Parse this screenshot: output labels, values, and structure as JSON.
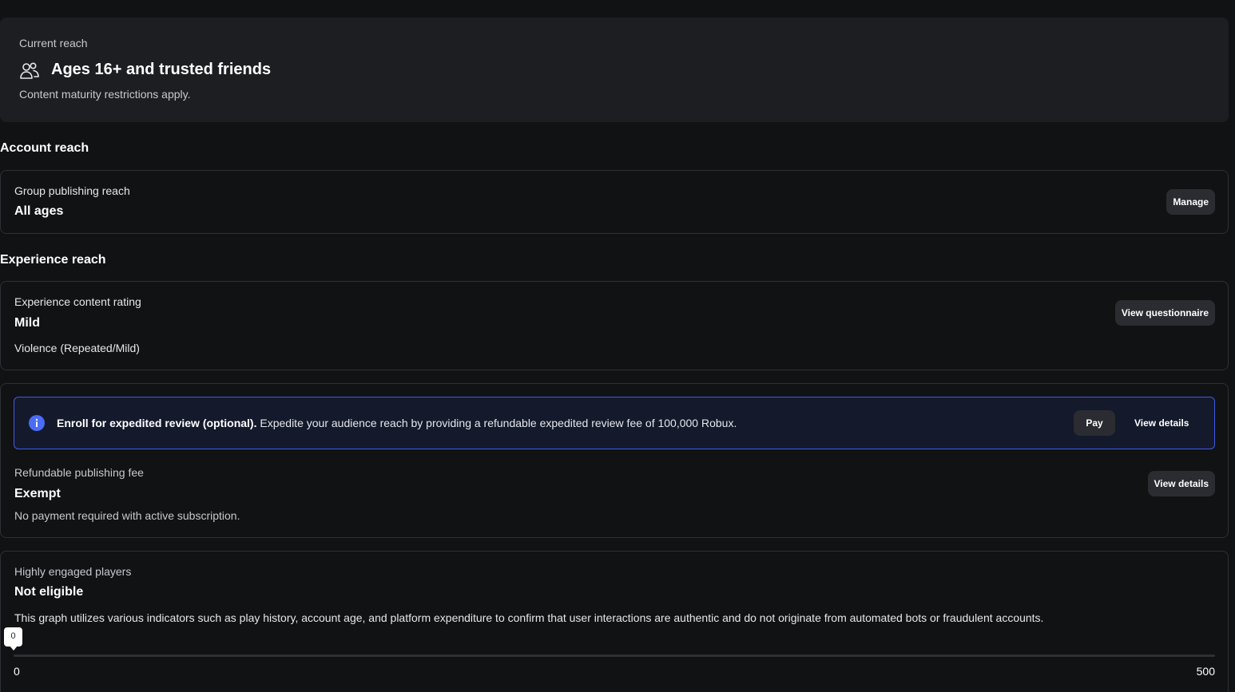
{
  "current_reach": {
    "label": "Current reach",
    "icon": "users-icon",
    "title": "Ages 16+ and trusted friends",
    "subtitle": "Content maturity restrictions apply."
  },
  "account_reach": {
    "heading": "Account reach",
    "group_publishing": {
      "label": "Group publishing reach",
      "value": "All ages",
      "button": "Manage"
    }
  },
  "experience_reach": {
    "heading": "Experience reach",
    "content_rating": {
      "label": "Experience content rating",
      "value": "Mild",
      "descriptor": "Violence (Repeated/Mild)",
      "button": "View questionnaire"
    },
    "expedited_banner": {
      "icon": "info-icon",
      "title": "Enroll for expedited review (optional).",
      "text": "Expedite your audience reach by providing a refundable expedited review fee of 100,000 Robux.",
      "pay_button": "Pay",
      "details_button": "View details",
      "accent": "#3f5ae8"
    },
    "publishing_fee": {
      "label": "Refundable publishing fee",
      "value": "Exempt",
      "description": "No payment required with active subscription.",
      "button": "View details"
    },
    "engaged_players": {
      "label": "Highly engaged players",
      "value": "Not eligible",
      "description": "This graph utilizes various indicators such as play history, account age, and platform expenditure to confirm that user interactions are authentic and do not originate from automated bots or fraudulent accounts.",
      "slider": {
        "current": "0",
        "min": "0",
        "max": "500"
      }
    }
  }
}
